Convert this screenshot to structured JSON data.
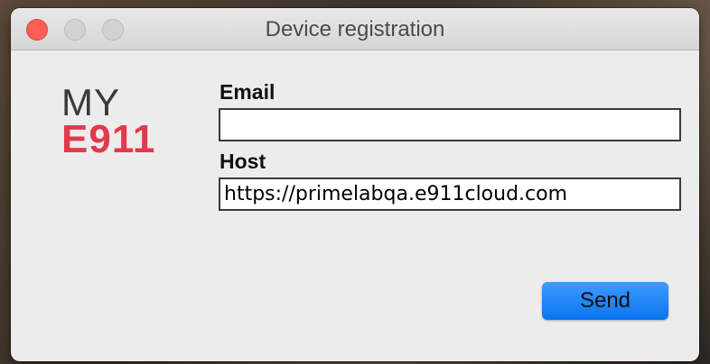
{
  "window": {
    "title": "Device registration",
    "controls": {
      "close": "close-icon",
      "minimize": "minimize-icon",
      "maximize": "maximize-icon"
    }
  },
  "logo": {
    "line1": "MY",
    "line2": "E911",
    "accent_color": "#e23a4c"
  },
  "form": {
    "email_label": "Email",
    "email_value": "",
    "host_label": "Host",
    "host_value": "https://primelabqa.e911cloud.com",
    "send_label": "Send"
  },
  "colors": {
    "primary_button": "#1a82f7",
    "window_bg": "#ececec"
  }
}
